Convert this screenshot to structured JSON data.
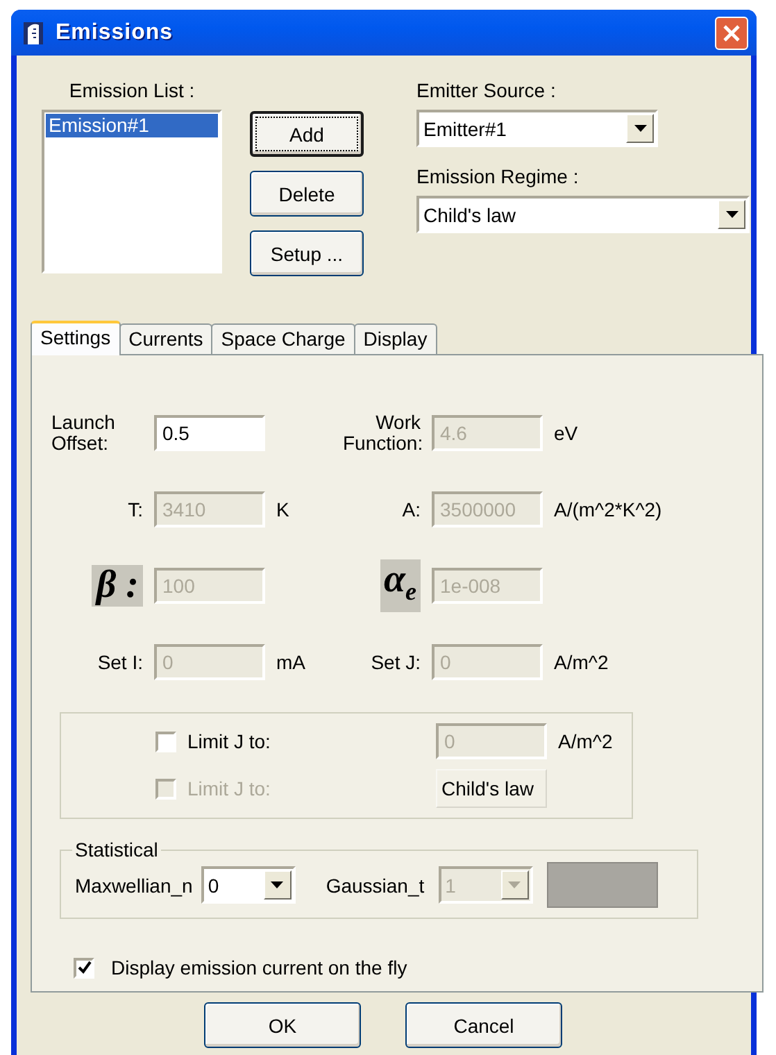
{
  "window": {
    "title": "Emissions"
  },
  "emission_list": {
    "label": "Emission List :",
    "items": [
      {
        "label": "Emission#1",
        "selected": true
      }
    ]
  },
  "list_buttons": [
    {
      "label": "Add",
      "focused": true
    },
    {
      "label": "Delete",
      "focused": false
    },
    {
      "label": "Setup ...",
      "focused": false
    }
  ],
  "emitter_source": {
    "label": "Emitter Source :",
    "value": "Emitter#1"
  },
  "emission_regime": {
    "label": "Emission Regime :",
    "value": "Child's law"
  },
  "tabs": [
    {
      "label": "Settings",
      "selected": true
    },
    {
      "label": "Currents",
      "selected": false
    },
    {
      "label": "Space Charge",
      "selected": false
    },
    {
      "label": "Display",
      "selected": false
    }
  ],
  "settings": {
    "fields": [
      {
        "kind": "text",
        "label": "Launch Offset:",
        "value": "0.5",
        "disabled": false
      },
      {
        "kind": "text",
        "label": "Work Function:",
        "value": "4.6",
        "unit": "eV",
        "disabled": true
      },
      {
        "kind": "text",
        "label": "T:",
        "value": "3410",
        "unit": "K",
        "disabled": true
      },
      {
        "kind": "text",
        "label": "A:",
        "value": "3500000",
        "unit": "A/(m^2*K^2)",
        "disabled": true
      },
      {
        "kind": "symbol",
        "label": "β :",
        "value": "100",
        "disabled": true
      },
      {
        "kind": "symbol",
        "label": "α$_{e}$",
        "value": "1e-008",
        "disabled": true
      },
      {
        "kind": "text",
        "label": "Set I:",
        "value": "0",
        "unit": "mA",
        "disabled": true
      },
      {
        "kind": "text",
        "label": "Set J:",
        "value": "0",
        "unit": "A/m^2",
        "disabled": true
      }
    ]
  },
  "limit": {
    "options": [
      {
        "label": "Limit J to:",
        "checked": false,
        "disabled": false
      },
      {
        "label": "Limit J to:",
        "checked": false,
        "disabled": true
      }
    ],
    "value": {
      "value": "0",
      "unit": "A/m^2",
      "disabled": true
    },
    "regime": "Child's law"
  },
  "statistical": {
    "title": "Statistical",
    "maxwellian": {
      "label": "Maxwellian_n",
      "value": "0",
      "disabled": false
    },
    "gaussian": {
      "label": "Gaussian_t",
      "value": "1",
      "disabled": true
    }
  },
  "display_current": {
    "label": "Display emission current on the fly",
    "checked": true
  },
  "buttons": [
    "OK",
    "Cancel"
  ]
}
